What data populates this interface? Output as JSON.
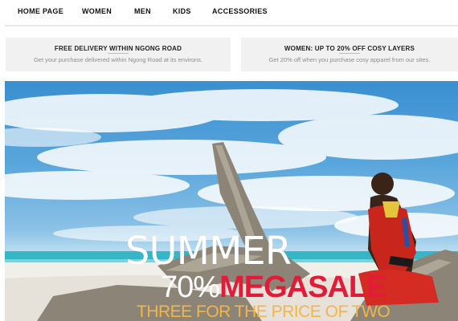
{
  "nav": {
    "items": [
      "HOME PAGE",
      "WOMEN",
      "MEN",
      "KIDS",
      "ACCESSORIES"
    ]
  },
  "promos": [
    {
      "title": "FREE DELIVERY WITHIN NGONG ROAD",
      "subtitle": "Get your purchase delivered within Ngong Road at its environs."
    },
    {
      "title": "WOMEN: UP TO 20% OFF COSY LAYERS",
      "subtitle": "Get 20% off when you purchase cosy apparel from our sites."
    }
  ],
  "hero": {
    "line1": "SUMMER",
    "line2_prefix": "70%",
    "line2_highlight": "MEGASALE",
    "line3": "THREE FOR THE PRICE OF TWO"
  },
  "colors": {
    "accent_red": "#e11b38",
    "accent_gold": "#f3b54a",
    "promo_bg": "#f1f1f1"
  }
}
